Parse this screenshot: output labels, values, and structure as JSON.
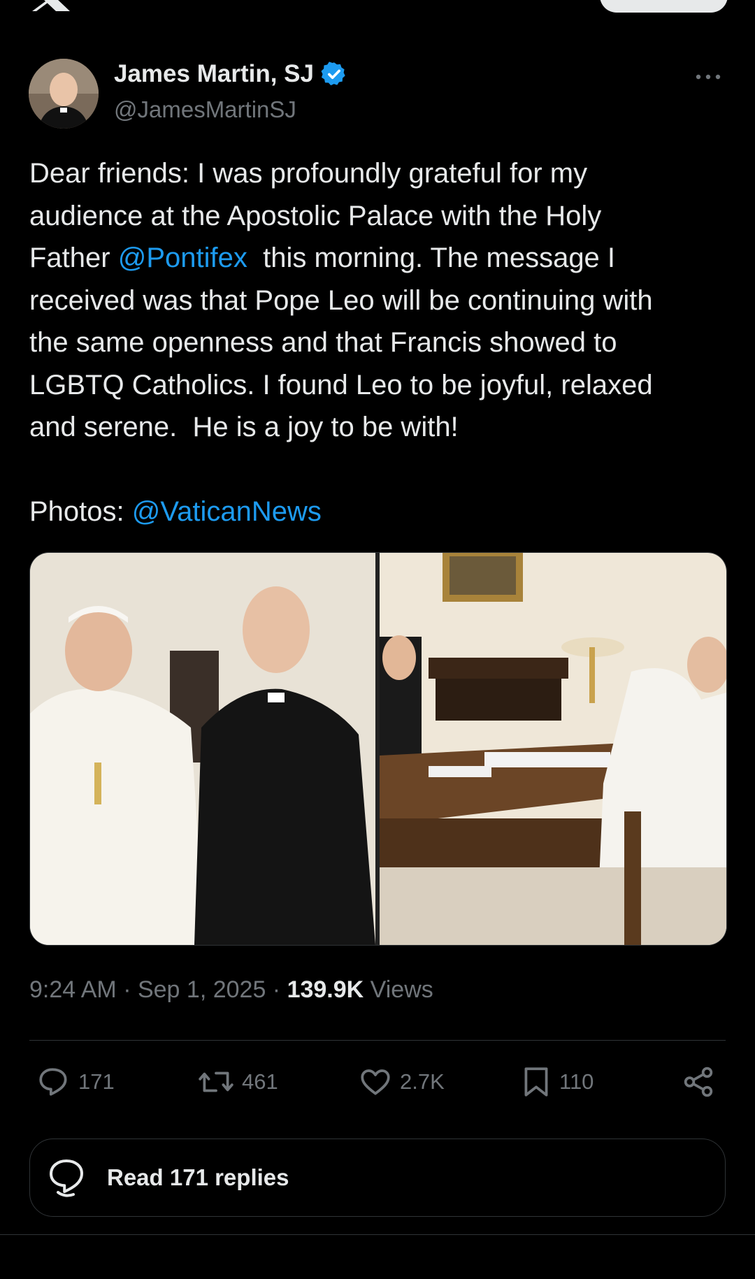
{
  "header": {
    "logo_icon": "x-logo-icon"
  },
  "author": {
    "name": "James Martin, SJ",
    "handle": "@JamesMartinSJ",
    "verified": true,
    "verified_color": "#1d9bf0"
  },
  "tweet": {
    "line1": "Dear friends: I was profoundly grateful for my",
    "line2": "audience at the Apostolic Palace with the Holy",
    "line3_pre": "Father ",
    "mention1": "@Pontifex",
    "line3_post": "  this morning. The message I",
    "line4": "received was that Pope Leo will be continuing with",
    "line5": "the same openness and that Francis showed to",
    "line6": "LGBTQ Catholics. I found Leo to be joyful, relaxed",
    "line7": "and serene.  He is a joy to be with!",
    "photos_prefix": "Photos: ",
    "mention2": "@VaticanNews"
  },
  "meta": {
    "time": "9:24 AM",
    "sep1": " · ",
    "date": "Sep 1, 2025",
    "sep2": " · ",
    "views_count": "139.9K",
    "views_label": " Views"
  },
  "actions": {
    "replies": "171",
    "reposts": "461",
    "likes": "2.7K",
    "bookmarks": "110"
  },
  "read_replies": {
    "label": "Read 171 replies"
  },
  "colors": {
    "accent": "#1d9bf0",
    "muted": "#71767b",
    "text": "#e7e9ea",
    "border": "#2f3336"
  }
}
